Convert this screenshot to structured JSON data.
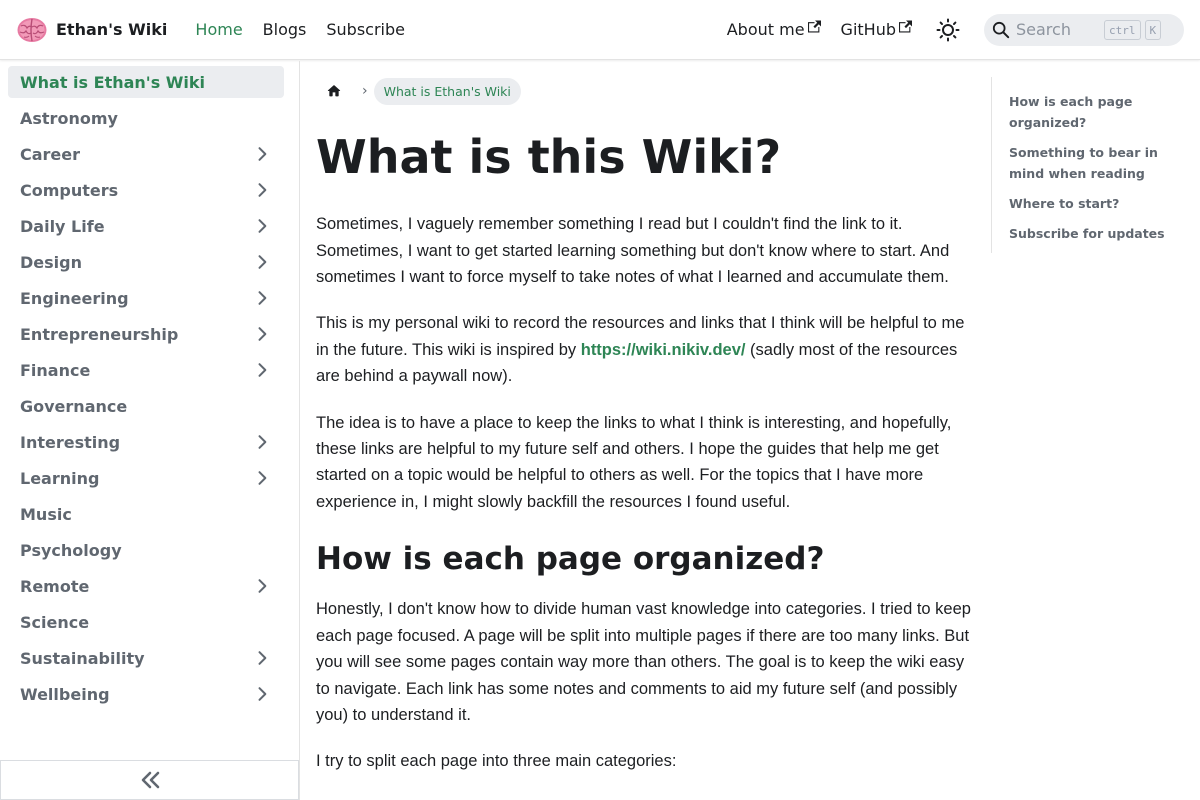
{
  "navbar": {
    "brand": "Ethan's Wiki",
    "links": [
      {
        "label": "Home",
        "active": true
      },
      {
        "label": "Blogs",
        "active": false
      },
      {
        "label": "Subscribe",
        "active": false
      }
    ],
    "external": [
      {
        "label": "About me",
        "icon": "external-link-icon"
      },
      {
        "label": "GitHub",
        "icon": "external-link-icon"
      }
    ],
    "theme_icon": "sun-icon",
    "search": {
      "placeholder": "Search",
      "key1": "ctrl",
      "key2": "K"
    }
  },
  "sidebar": {
    "items": [
      {
        "label": "What is Ethan's Wiki",
        "expandable": false,
        "active": true
      },
      {
        "label": "Astronomy",
        "expandable": false
      },
      {
        "label": "Career",
        "expandable": true
      },
      {
        "label": "Computers",
        "expandable": true
      },
      {
        "label": "Daily Life",
        "expandable": true
      },
      {
        "label": "Design",
        "expandable": true
      },
      {
        "label": "Engineering",
        "expandable": true
      },
      {
        "label": "Entrepreneurship",
        "expandable": true
      },
      {
        "label": "Finance",
        "expandable": true
      },
      {
        "label": "Governance",
        "expandable": false
      },
      {
        "label": "Interesting",
        "expandable": true
      },
      {
        "label": "Learning",
        "expandable": true
      },
      {
        "label": "Music",
        "expandable": false
      },
      {
        "label": "Psychology",
        "expandable": false
      },
      {
        "label": "Remote",
        "expandable": true
      },
      {
        "label": "Science",
        "expandable": false
      },
      {
        "label": "Sustainability",
        "expandable": true
      },
      {
        "label": "Wellbeing",
        "expandable": true
      }
    ],
    "collapse_icon": "double-chevron-left-icon"
  },
  "breadcrumb": {
    "current": "What is Ethan's Wiki"
  },
  "article": {
    "title": "What is this Wiki?",
    "p1": "Sometimes, I vaguely remember something I read but I couldn't find the link to it. Sometimes, I want to get started learning something but don't know where to start. And sometimes I want to force myself to take notes of what I learned and accumulate them.",
    "p2_before": "This is my personal wiki to record the resources and links that I think will be helpful to me in the future. This wiki is inspired by ",
    "p2_link": "https://wiki.nikiv.dev/",
    "p2_after": " (sadly most of the resources are behind a paywall now).",
    "p3": "The idea is to have a place to keep the links to what I think is interesting, and hopefully, these links are helpful to my future self and others. I hope the guides that help me get started on a topic would be helpful to others as well. For the topics that I have more experience in, I might slowly backfill the resources I found useful.",
    "h2": "How is each page organized?",
    "p4": "Honestly, I don't know how to divide human vast knowledge into categories. I tried to keep each page focused. A page will be split into multiple pages if there are too many links. But you will see some pages contain way more than others. The goal is to keep the wiki easy to navigate. Each link has some notes and comments to aid my future self (and possibly you) to understand it.",
    "p5": "I try to split each page into three main categories:"
  },
  "toc": {
    "items": [
      "How is each page organized?",
      "Something to bear in mind when reading",
      "Where to start?",
      "Subscribe for updates"
    ]
  },
  "colors": {
    "accent": "#2e8555",
    "text": "#1c1e21",
    "muted": "#606770"
  }
}
